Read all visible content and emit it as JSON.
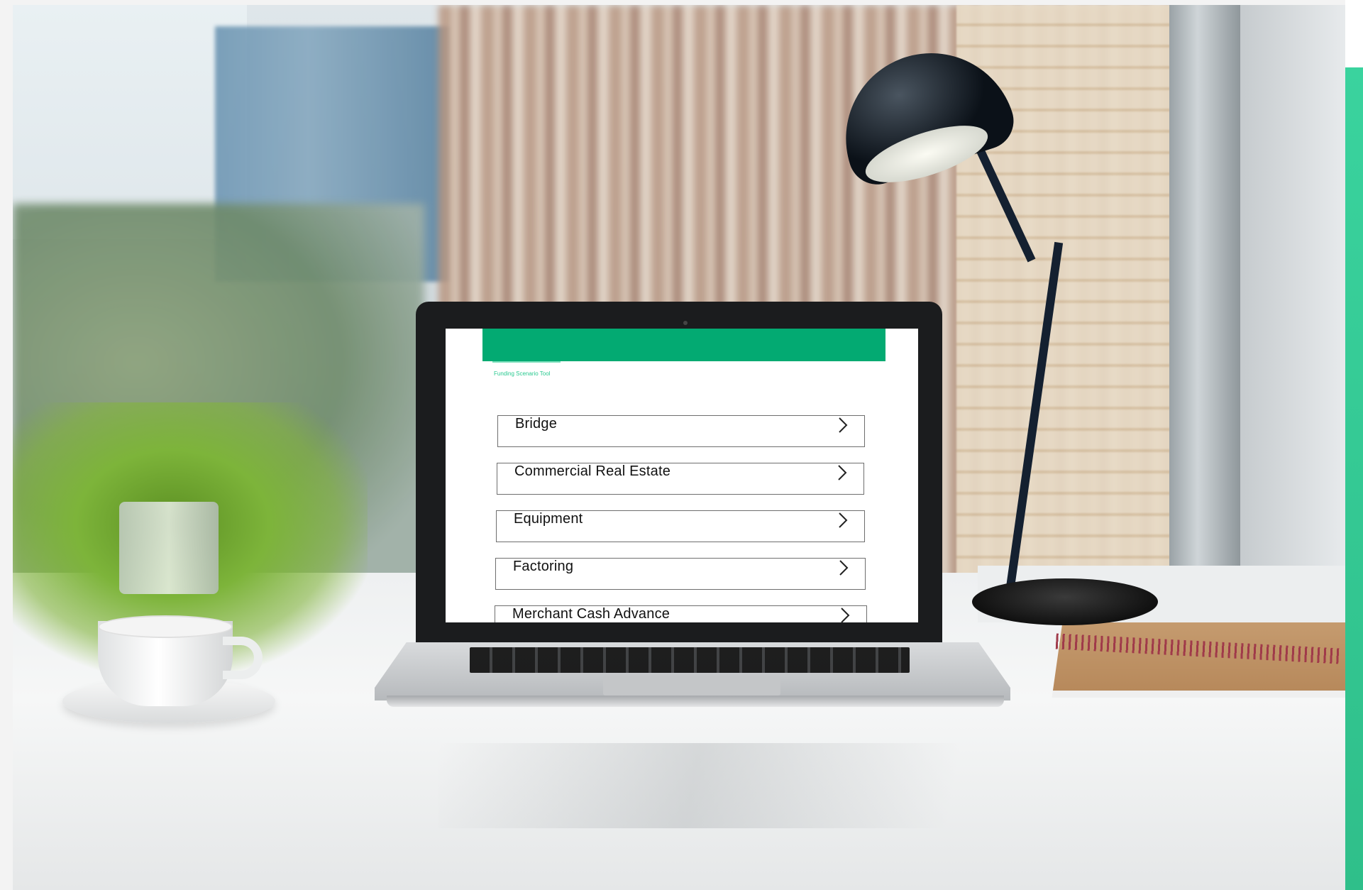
{
  "app": {
    "tool_label": "Funding Scenario Tool",
    "brand_color": "#03aa72",
    "accent_color": "#3ad39e"
  },
  "options": [
    {
      "label": "Bridge",
      "icon": "chevron-right-icon"
    },
    {
      "label": "Commercial Real Estate",
      "icon": "chevron-right-icon"
    },
    {
      "label": "Equipment",
      "icon": "chevron-right-icon"
    },
    {
      "label": "Factoring",
      "icon": "chevron-right-icon"
    },
    {
      "label": "Merchant Cash Advance",
      "icon": "chevron-right-icon"
    }
  ]
}
